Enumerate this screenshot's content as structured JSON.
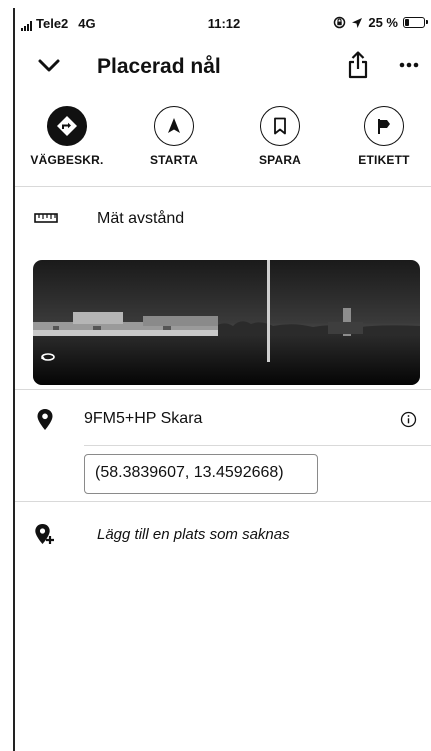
{
  "status_bar": {
    "carrier": "Tele2",
    "network": "4G",
    "time": "11:12",
    "battery": "25 %",
    "battery_level": 0.25
  },
  "header": {
    "title": "Placerad nål",
    "back_icon": "chevron-down-icon",
    "share_icon": "share-icon",
    "more_icon": "more-horizontal-icon"
  },
  "actions": [
    {
      "label": "VÄGBESKR.",
      "icon": "directions-icon",
      "active": true
    },
    {
      "label": "STARTA",
      "icon": "navigation-arrow-icon",
      "active": false
    },
    {
      "label": "SPARA",
      "icon": "bookmark-icon",
      "active": false
    },
    {
      "label": "ETIKETT",
      "icon": "flag-icon",
      "active": false
    }
  ],
  "measure": {
    "label": "Mät avstånd",
    "icon": "ruler-icon"
  },
  "street_view": {
    "icon": "street-view-rotate-icon"
  },
  "plus_code": {
    "label": "9FM5+HP Skara",
    "icon": "location-pin-icon",
    "info_icon": "info-icon"
  },
  "coordinates": {
    "value": "(58.3839607, 13.4592668)"
  },
  "add_place": {
    "label": "Lägg till en plats som saknas",
    "icon": "add-location-icon"
  }
}
